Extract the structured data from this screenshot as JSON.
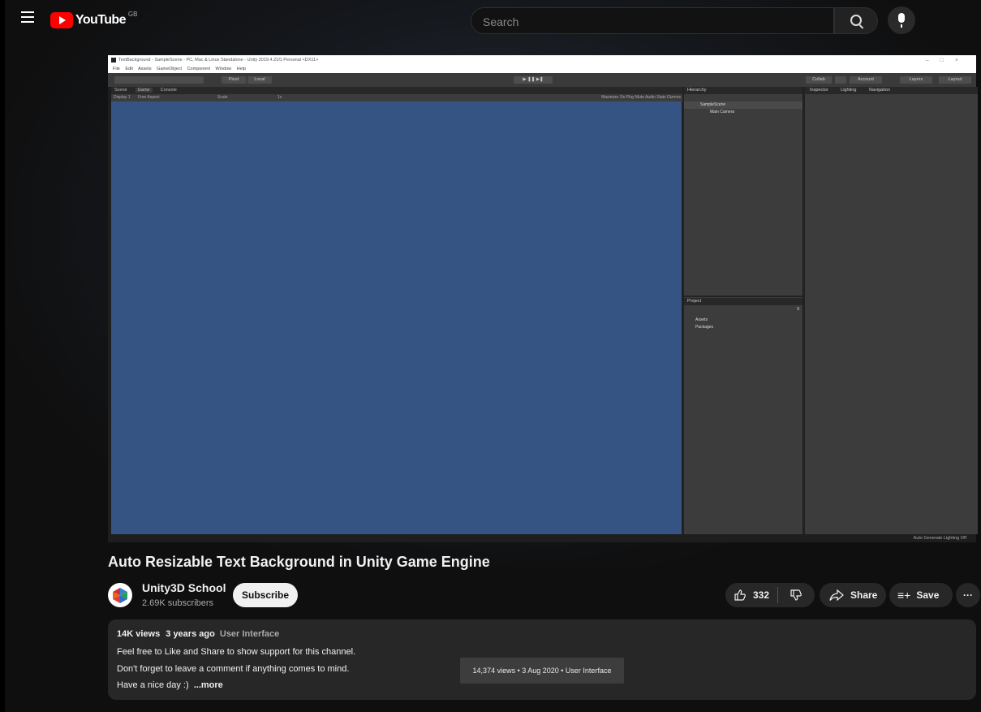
{
  "masthead": {
    "logo_text": "YouTube",
    "country_code": "GB",
    "search_placeholder": "Search"
  },
  "player": {
    "unity": {
      "window_title": "TextBackground - SampleScene - PC, Mac & Linux Standalone - Unity 2019.4.21f1 Personal <DX11>",
      "menu": [
        "File",
        "Edit",
        "Assets",
        "GameObject",
        "Component",
        "Window",
        "Help"
      ],
      "toolbar_pivot": "Pivot",
      "toolbar_local": "Local",
      "toolbar_right": [
        "Collab",
        "Account",
        "Layers",
        "Layout"
      ],
      "left_tabs": [
        "Scene",
        "Game",
        "Console"
      ],
      "game_bar": {
        "display": "Display 1",
        "aspect": "Free Aspect",
        "scale_label": "Scale",
        "scale_value": "1x",
        "right": "Maximize On Play   Mute Audio   Stats   Gizmos"
      },
      "hierarchy": {
        "tab": "Hierarchy",
        "scene": "SampleScene",
        "camera": "Main Camera"
      },
      "project": {
        "tab": "Project",
        "count": "9",
        "folders": [
          "Assets",
          "Packages"
        ]
      },
      "inspector_tabs": [
        "Inspector",
        "Lighting",
        "Navigation"
      ],
      "status": "Auto Generate Lighting Off"
    }
  },
  "video": {
    "title": "Auto Resizable Text Background in Unity Game Engine"
  },
  "channel": {
    "name": "Unity3D School",
    "subscribers": "2.69K subscribers",
    "subscribe_label": "Subscribe"
  },
  "actions": {
    "likes": "332",
    "share_label": "Share",
    "save_label": "Save",
    "more_label": "···"
  },
  "description": {
    "views": "14K views",
    "age": "3 years ago",
    "tag": "User Interface",
    "lines": [
      "Feel free to Like and Share to show support for this channel.",
      "Don't forget to leave a comment if anything comes to mind.",
      "Have a nice day :)"
    ],
    "more_label": "...more",
    "tooltip": "14,374 views • 3 Aug 2020 • User Interface"
  }
}
